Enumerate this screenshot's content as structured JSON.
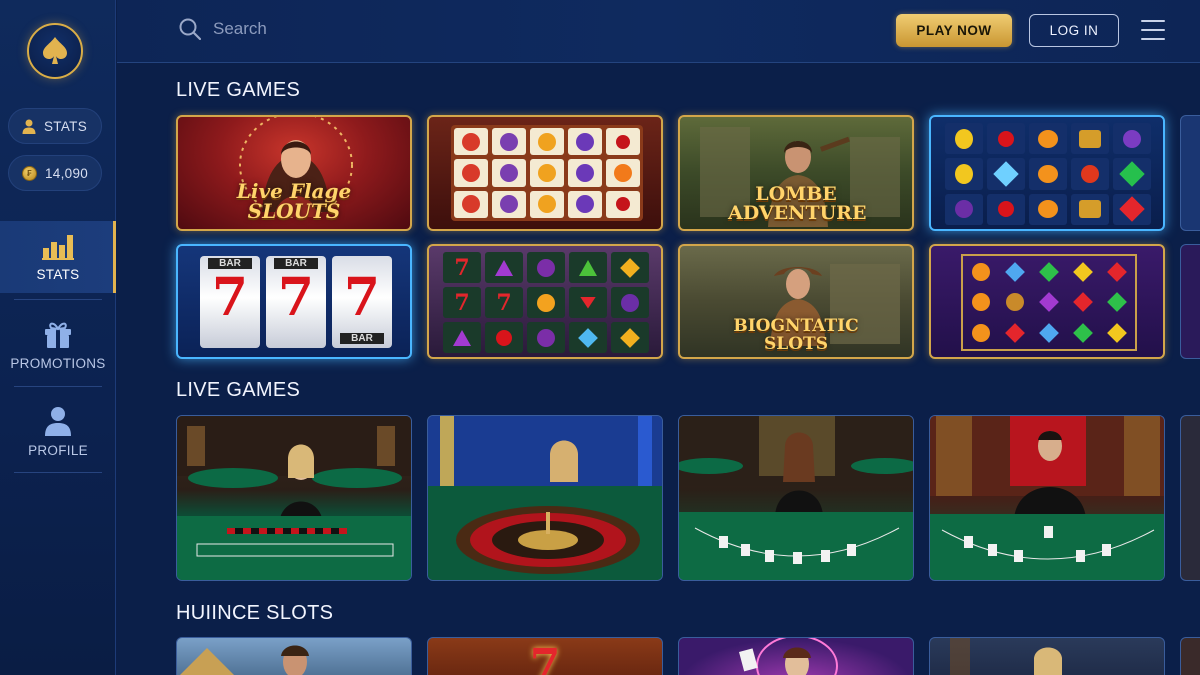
{
  "sidebar": {
    "stats_pill": "STATS",
    "balance_pill": "14,090",
    "nav": [
      {
        "label": "STATS",
        "icon": "bar-chart-icon",
        "active": true
      },
      {
        "label": "PROMOTIONS",
        "icon": "gift-icon",
        "active": false
      },
      {
        "label": "PROFILE",
        "icon": "user-icon",
        "active": false
      }
    ]
  },
  "header": {
    "search_placeholder": "Search",
    "play_now": "PLAY NOW",
    "log_in": "LOG IN"
  },
  "sections": [
    {
      "title": "LIVE GAMES",
      "cards": [
        {
          "title": "Live Flage SLOUTS"
        },
        {
          "title": ""
        },
        {
          "title": "LOMBE ADVENTURE"
        },
        {
          "title": ""
        },
        {
          "title": ""
        },
        {
          "title": ""
        },
        {
          "title": "BIOGNTATIC SLOTS"
        },
        {
          "title": ""
        }
      ]
    },
    {
      "title": "LIVE GAMES",
      "cards": [
        {
          "title": ""
        },
        {
          "title": ""
        },
        {
          "title": ""
        },
        {
          "title": ""
        }
      ]
    },
    {
      "title": "HUIINCE SLOTS",
      "cards": [
        {
          "title": ""
        },
        {
          "title": ""
        },
        {
          "title": ""
        },
        {
          "title": ""
        }
      ]
    }
  ],
  "slot_777": {
    "reel_top": "BAR",
    "symbol": "7",
    "reel_bottom": "BAR"
  },
  "colors": {
    "accent_gold": "#d9ad47",
    "glow_blue": "#4ab6ff",
    "bg": "#0b1f49"
  }
}
